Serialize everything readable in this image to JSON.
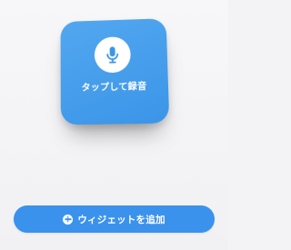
{
  "widget": {
    "icon": "microphone-icon",
    "label": "タップして録音",
    "background_color": "#4a9fed"
  },
  "add_button": {
    "icon": "plus-circle-icon",
    "label": "ウィジェットを追加",
    "background_color": "#3b92ec"
  }
}
